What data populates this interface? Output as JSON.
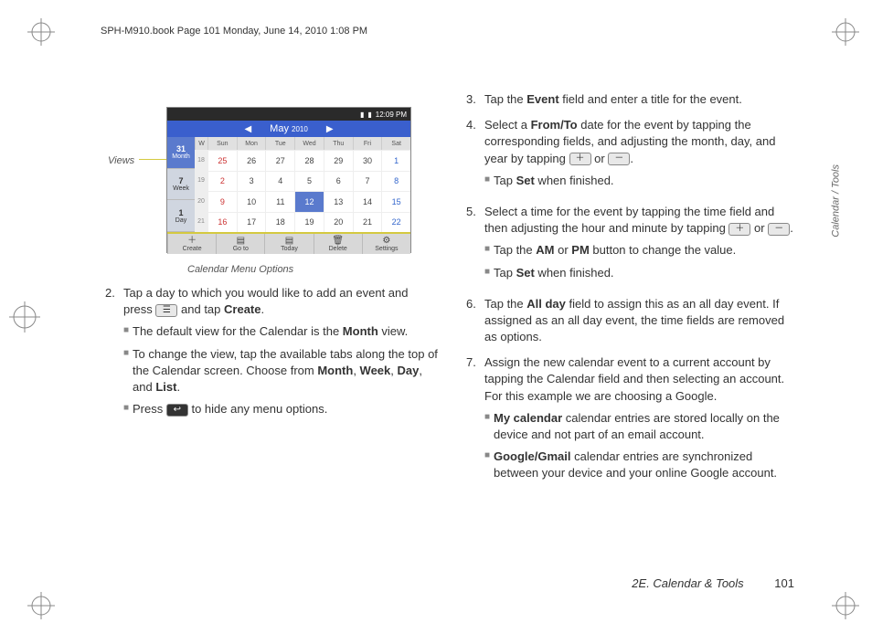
{
  "header": {
    "crop_text": "SPH-M910.book  Page 101  Monday, June 14, 2010  1:08 PM"
  },
  "labels": {
    "views": "Views",
    "menu_options": "Calendar Menu Options"
  },
  "screenshot": {
    "time": "12:09 PM",
    "month": "May",
    "year": "2010",
    "tabs": [
      {
        "label": "Month",
        "num": "31"
      },
      {
        "label": "Week",
        "num": "7"
      },
      {
        "label": "Day",
        "num": "1"
      }
    ],
    "dow": [
      "W",
      "Sun",
      "Mon",
      "Tue",
      "Wed",
      "Thu",
      "Fri",
      "Sat"
    ],
    "rows": [
      {
        "wn": "18",
        "days": [
          "25",
          "26",
          "27",
          "28",
          "29",
          "30",
          "1"
        ]
      },
      {
        "wn": "19",
        "days": [
          "2",
          "3",
          "4",
          "5",
          "6",
          "7",
          "8"
        ]
      },
      {
        "wn": "20",
        "days": [
          "9",
          "10",
          "11",
          "12",
          "13",
          "14",
          "15"
        ]
      },
      {
        "wn": "21",
        "days": [
          "16",
          "17",
          "18",
          "19",
          "20",
          "21",
          "22"
        ]
      }
    ],
    "today": "12",
    "toolbar": [
      {
        "icon": "＋",
        "label": "Create"
      },
      {
        "icon": "▤",
        "label": "Go to"
      },
      {
        "icon": "▤",
        "label": "Today"
      },
      {
        "icon": "🗑",
        "label": "Delete"
      },
      {
        "icon": "⚙",
        "label": "Settings"
      }
    ]
  },
  "left": {
    "step2_num": "2.",
    "step2_a": "Tap a day to which you would like to add an event and press ",
    "step2_b": " and tap ",
    "step2_create": "Create",
    "step2_c": ".",
    "sub1_a": "The default view for the Calendar is the ",
    "sub1_month": "Month",
    "sub1_b": " view.",
    "sub2_a": "To change the view, tap the available tabs along the top of the Calendar screen. Choose from ",
    "sub2_m": "Month",
    "sub2_w": "Week",
    "sub2_d": "Day",
    "sub2_l": "List",
    "sub2_b": ", ",
    "sub2_c": ", ",
    "sub2_and": ", and ",
    "sub2_end": ".",
    "sub3_a": "Press ",
    "sub3_b": " to hide any menu options."
  },
  "right": {
    "s3_num": "3.",
    "s3": "Tap the ",
    "s3_ev": "Event",
    "s3_b": " field and enter a title for the event.",
    "s4_num": "4.",
    "s4_a": "Select a ",
    "s4_ft": "From/To",
    "s4_b": " date for the event by tapping the corresponding fields, and adjusting the month, day, and year by tapping ",
    "s4_c": " or ",
    "s4_d": ".",
    "s4_sub1_a": "Tap ",
    "s4_sub1_set": "Set",
    "s4_sub1_b": " when finished.",
    "s5_num": "5.",
    "s5_a": "Select a time for the event by tapping the time field and then adjusting the hour and minute by tapping ",
    "s5_b": " or ",
    "s5_c": ".",
    "s5_sub1_a": "Tap the ",
    "s5_sub1_am": "AM",
    "s5_sub1_or": " or ",
    "s5_sub1_pm": "PM",
    "s5_sub1_b": " button to change the value.",
    "s5_sub2_a": "Tap ",
    "s5_sub2_set": "Set",
    "s5_sub2_b": " when finished.",
    "s6_num": "6.",
    "s6_a": "Tap the ",
    "s6_ad": "All day",
    "s6_b": " field to assign this as an all day event. If assigned as an all day event, the time fields are removed as options.",
    "s7_num": "7.",
    "s7": "Assign the new calendar event to a current account by tapping the Calendar field and then selecting an account. For this example we are choosing a Google.",
    "s7_sub1_a": "My calendar",
    "s7_sub1_b": " calendar entries are stored locally on the device and not part of an email account.",
    "s7_sub2_a": "Google/Gmail",
    "s7_sub2_b": " calendar entries are synchronized between your device and your online Google account."
  },
  "side_tab": "Calendar / Tools",
  "footer": {
    "section": "2E. Calendar & Tools",
    "page": "101"
  }
}
